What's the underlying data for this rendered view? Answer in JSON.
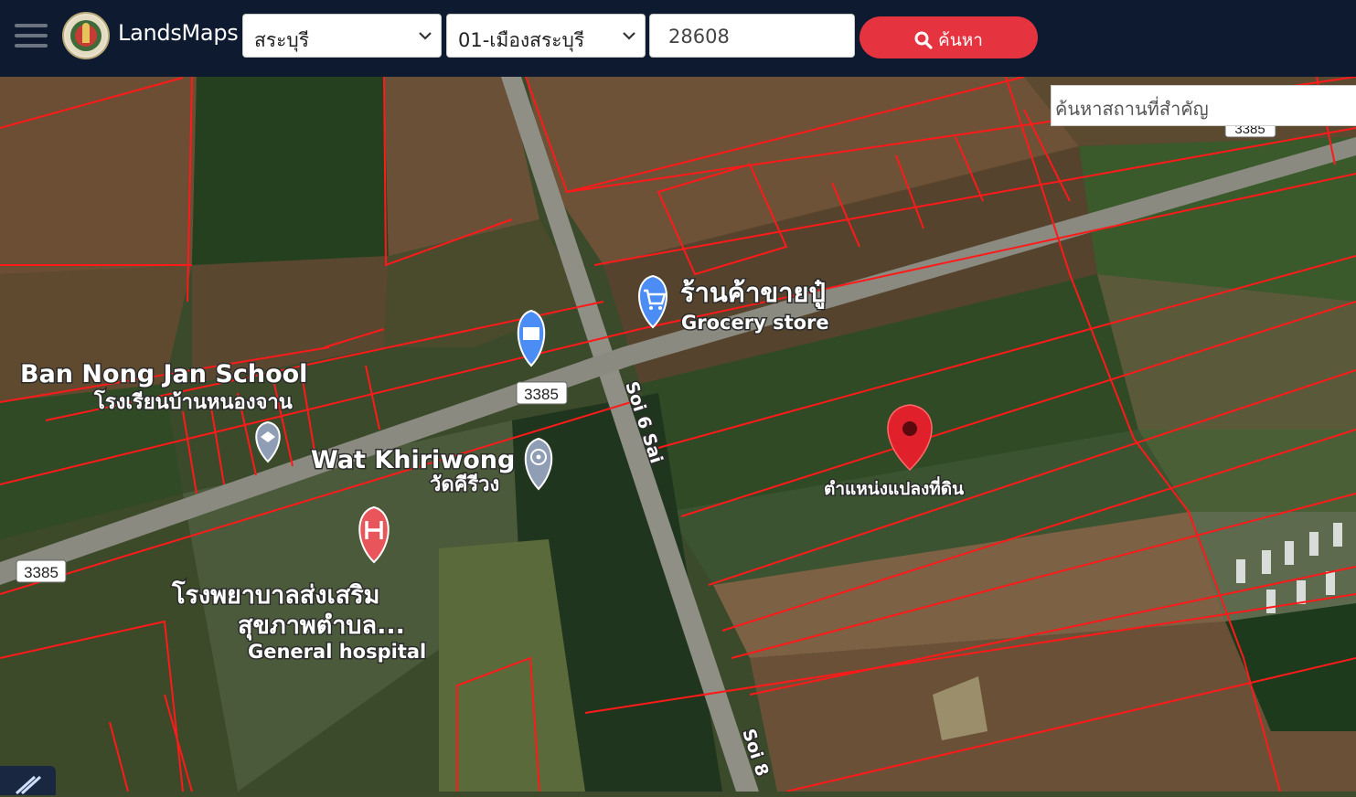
{
  "header": {
    "brand": "LandsMaps",
    "province": "สระบุรี",
    "district": "01-เมืองสระบุรี",
    "parcel_number": "28608",
    "search_label": "ค้นหา"
  },
  "map": {
    "place_search_placeholder": "ค้นหาสถานที่สำคัญ",
    "labels": {
      "school_en": "Ban Nong Jan School",
      "school_th": "โรงเรียนบ้านหนองจาน",
      "temple_en": "Wat Khiriwong",
      "temple_th": "วัดคีรีวง",
      "hospital_th_1": "โรงพยาบาลส่งเสริม",
      "hospital_th_2": "สุขภาพตำบล...",
      "hospital_en": "General hospital",
      "store_th": "ร้านค้าขายปู๋",
      "store_en": "Grocery store",
      "parcel_marker": "ตำแหน่งแปลงที่ดิน",
      "road_3385_a": "3385",
      "road_3385_b": "3385",
      "road_3385_c": "3385",
      "soi_a": "Soi 6 Sai",
      "soi_b": "Soi 8"
    },
    "colors": {
      "boundary": "#ff1a1a",
      "marker": "#e0202a",
      "poi_blue": "#4c8cf5",
      "poi_red": "#e8555a",
      "poi_gray": "#8f9db5"
    }
  }
}
